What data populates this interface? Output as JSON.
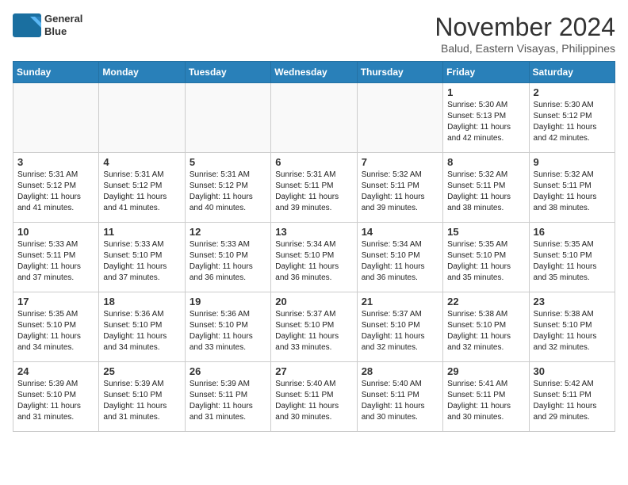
{
  "logo": {
    "line1": "General",
    "line2": "Blue"
  },
  "title": "November 2024",
  "subtitle": "Balud, Eastern Visayas, Philippines",
  "days_header": [
    "Sunday",
    "Monday",
    "Tuesday",
    "Wednesday",
    "Thursday",
    "Friday",
    "Saturday"
  ],
  "weeks": [
    [
      {
        "day": "",
        "info": ""
      },
      {
        "day": "",
        "info": ""
      },
      {
        "day": "",
        "info": ""
      },
      {
        "day": "",
        "info": ""
      },
      {
        "day": "",
        "info": ""
      },
      {
        "day": "1",
        "info": "Sunrise: 5:30 AM\nSunset: 5:13 PM\nDaylight: 11 hours\nand 42 minutes."
      },
      {
        "day": "2",
        "info": "Sunrise: 5:30 AM\nSunset: 5:12 PM\nDaylight: 11 hours\nand 42 minutes."
      }
    ],
    [
      {
        "day": "3",
        "info": "Sunrise: 5:31 AM\nSunset: 5:12 PM\nDaylight: 11 hours\nand 41 minutes."
      },
      {
        "day": "4",
        "info": "Sunrise: 5:31 AM\nSunset: 5:12 PM\nDaylight: 11 hours\nand 41 minutes."
      },
      {
        "day": "5",
        "info": "Sunrise: 5:31 AM\nSunset: 5:12 PM\nDaylight: 11 hours\nand 40 minutes."
      },
      {
        "day": "6",
        "info": "Sunrise: 5:31 AM\nSunset: 5:11 PM\nDaylight: 11 hours\nand 39 minutes."
      },
      {
        "day": "7",
        "info": "Sunrise: 5:32 AM\nSunset: 5:11 PM\nDaylight: 11 hours\nand 39 minutes."
      },
      {
        "day": "8",
        "info": "Sunrise: 5:32 AM\nSunset: 5:11 PM\nDaylight: 11 hours\nand 38 minutes."
      },
      {
        "day": "9",
        "info": "Sunrise: 5:32 AM\nSunset: 5:11 PM\nDaylight: 11 hours\nand 38 minutes."
      }
    ],
    [
      {
        "day": "10",
        "info": "Sunrise: 5:33 AM\nSunset: 5:11 PM\nDaylight: 11 hours\nand 37 minutes."
      },
      {
        "day": "11",
        "info": "Sunrise: 5:33 AM\nSunset: 5:10 PM\nDaylight: 11 hours\nand 37 minutes."
      },
      {
        "day": "12",
        "info": "Sunrise: 5:33 AM\nSunset: 5:10 PM\nDaylight: 11 hours\nand 36 minutes."
      },
      {
        "day": "13",
        "info": "Sunrise: 5:34 AM\nSunset: 5:10 PM\nDaylight: 11 hours\nand 36 minutes."
      },
      {
        "day": "14",
        "info": "Sunrise: 5:34 AM\nSunset: 5:10 PM\nDaylight: 11 hours\nand 36 minutes."
      },
      {
        "day": "15",
        "info": "Sunrise: 5:35 AM\nSunset: 5:10 PM\nDaylight: 11 hours\nand 35 minutes."
      },
      {
        "day": "16",
        "info": "Sunrise: 5:35 AM\nSunset: 5:10 PM\nDaylight: 11 hours\nand 35 minutes."
      }
    ],
    [
      {
        "day": "17",
        "info": "Sunrise: 5:35 AM\nSunset: 5:10 PM\nDaylight: 11 hours\nand 34 minutes."
      },
      {
        "day": "18",
        "info": "Sunrise: 5:36 AM\nSunset: 5:10 PM\nDaylight: 11 hours\nand 34 minutes."
      },
      {
        "day": "19",
        "info": "Sunrise: 5:36 AM\nSunset: 5:10 PM\nDaylight: 11 hours\nand 33 minutes."
      },
      {
        "day": "20",
        "info": "Sunrise: 5:37 AM\nSunset: 5:10 PM\nDaylight: 11 hours\nand 33 minutes."
      },
      {
        "day": "21",
        "info": "Sunrise: 5:37 AM\nSunset: 5:10 PM\nDaylight: 11 hours\nand 32 minutes."
      },
      {
        "day": "22",
        "info": "Sunrise: 5:38 AM\nSunset: 5:10 PM\nDaylight: 11 hours\nand 32 minutes."
      },
      {
        "day": "23",
        "info": "Sunrise: 5:38 AM\nSunset: 5:10 PM\nDaylight: 11 hours\nand 32 minutes."
      }
    ],
    [
      {
        "day": "24",
        "info": "Sunrise: 5:39 AM\nSunset: 5:10 PM\nDaylight: 11 hours\nand 31 minutes."
      },
      {
        "day": "25",
        "info": "Sunrise: 5:39 AM\nSunset: 5:10 PM\nDaylight: 11 hours\nand 31 minutes."
      },
      {
        "day": "26",
        "info": "Sunrise: 5:39 AM\nSunset: 5:11 PM\nDaylight: 11 hours\nand 31 minutes."
      },
      {
        "day": "27",
        "info": "Sunrise: 5:40 AM\nSunset: 5:11 PM\nDaylight: 11 hours\nand 30 minutes."
      },
      {
        "day": "28",
        "info": "Sunrise: 5:40 AM\nSunset: 5:11 PM\nDaylight: 11 hours\nand 30 minutes."
      },
      {
        "day": "29",
        "info": "Sunrise: 5:41 AM\nSunset: 5:11 PM\nDaylight: 11 hours\nand 30 minutes."
      },
      {
        "day": "30",
        "info": "Sunrise: 5:42 AM\nSunset: 5:11 PM\nDaylight: 11 hours\nand 29 minutes."
      }
    ]
  ]
}
